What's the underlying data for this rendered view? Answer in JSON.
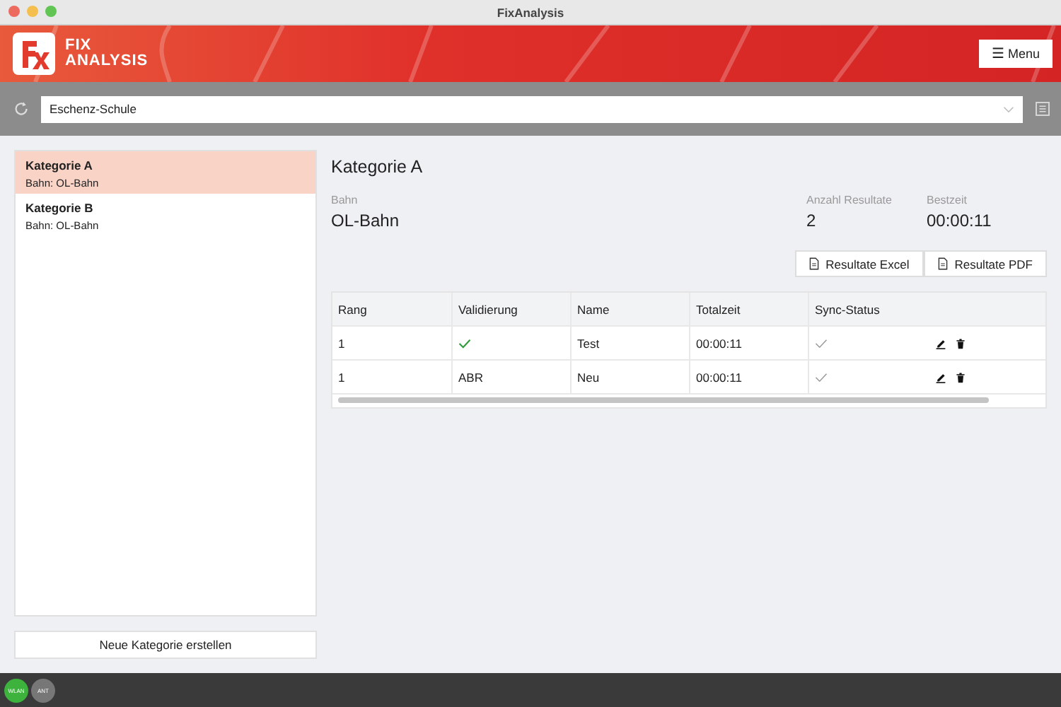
{
  "window": {
    "title": "FixAnalysis"
  },
  "header": {
    "logo_text": [
      "FIX",
      "ANALYSIS"
    ],
    "menu_button": {
      "icon": "☰",
      "label": "Menu"
    }
  },
  "toolbar": {
    "select": {
      "value": "Eschenz-Schule"
    }
  },
  "sidebar": {
    "items": [
      {
        "title": "Kategorie A",
        "subtitle": "Bahn: OL-Bahn",
        "selected": true
      },
      {
        "title": "Kategorie B",
        "subtitle": "Bahn: OL-Bahn",
        "selected": false
      }
    ],
    "create_button": "Neue Kategorie erstellen"
  },
  "detail": {
    "title": "Kategorie A",
    "stats": [
      {
        "label": "Bahn",
        "value": "OL-Bahn"
      },
      {
        "label": "Anzahl Resultate",
        "value": "2"
      },
      {
        "label": "Bestzeit",
        "value": "00:00:11"
      }
    ],
    "export_buttons": [
      "Resultate Excel",
      "Resultate PDF"
    ],
    "table": {
      "columns": [
        "Rang",
        "Validierung",
        "Name",
        "Totalzeit",
        "Sync-Status"
      ],
      "rows": [
        {
          "rang": "1",
          "validation": {
            "kind": "check"
          },
          "name": "Test",
          "time": "00:00:11",
          "synced": true
        },
        {
          "rang": "1",
          "validation": {
            "kind": "text",
            "text": "ABR"
          },
          "name": "Neu",
          "time": "00:00:11",
          "synced": true
        }
      ]
    }
  },
  "status_bar": {
    "indicators": [
      {
        "label": "WLAN",
        "on": true
      },
      {
        "label": "ANT",
        "on": false
      }
    ]
  }
}
